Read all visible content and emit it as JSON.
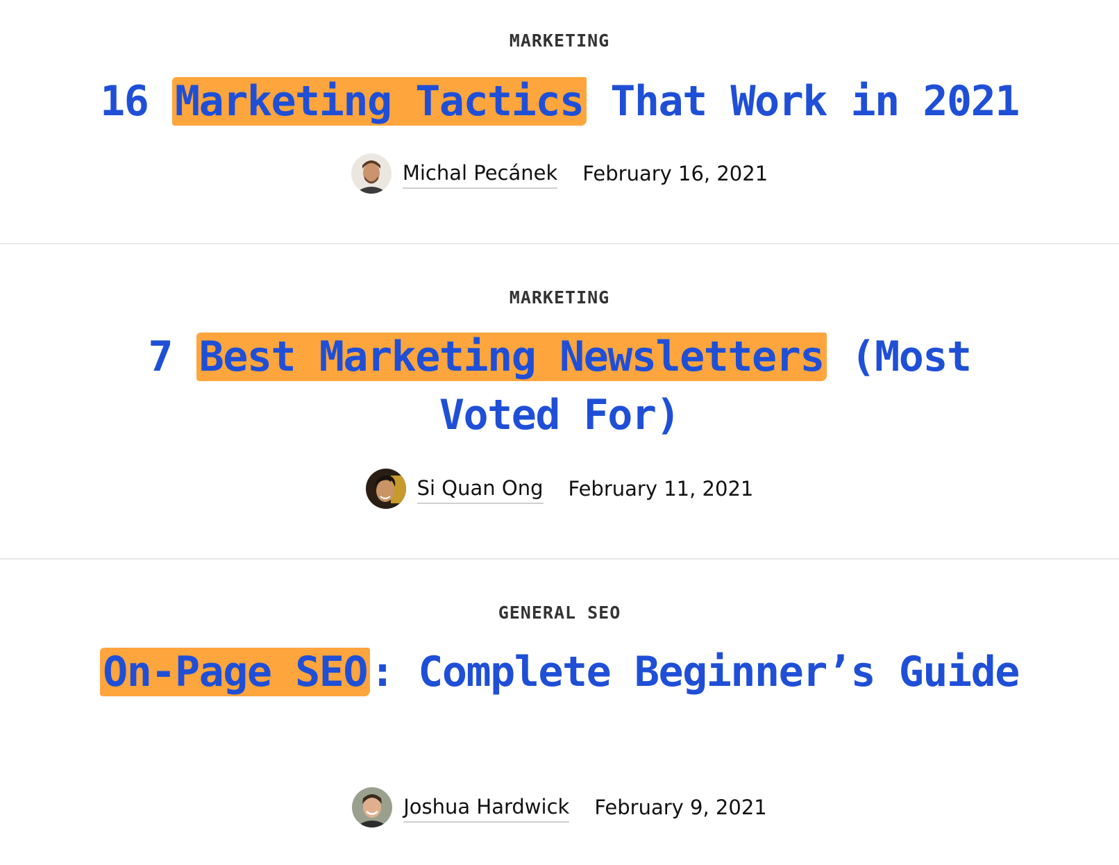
{
  "posts": [
    {
      "category": "MARKETING",
      "title_highlight_before": "16 ",
      "title_highlight": "Marketing Tactics",
      "title_after": " That Work in 2021",
      "author": "Michal Pecánek",
      "date": "February 16, 2021"
    },
    {
      "category": "MARKETING",
      "title_highlight_before": "7 ",
      "title_highlight": "Best Marketing Newsletters",
      "title_after": " (Most Voted For)",
      "author": "Si Quan Ong",
      "date": "February 11, 2021"
    },
    {
      "category": "GENERAL SEO",
      "title_highlight_before": "",
      "title_highlight": "On-Page SEO",
      "title_after": ": Complete Beginner’s Guide",
      "author": "Joshua Hardwick",
      "date": "February 9, 2021"
    }
  ],
  "colors": {
    "title": "#1f4fd6",
    "highlight": "#ffa53d",
    "category": "#333333",
    "text": "#111111",
    "divider": "#e8e8e8"
  },
  "icons": [
    "avatar-michal",
    "avatar-si-quan",
    "avatar-joshua"
  ]
}
